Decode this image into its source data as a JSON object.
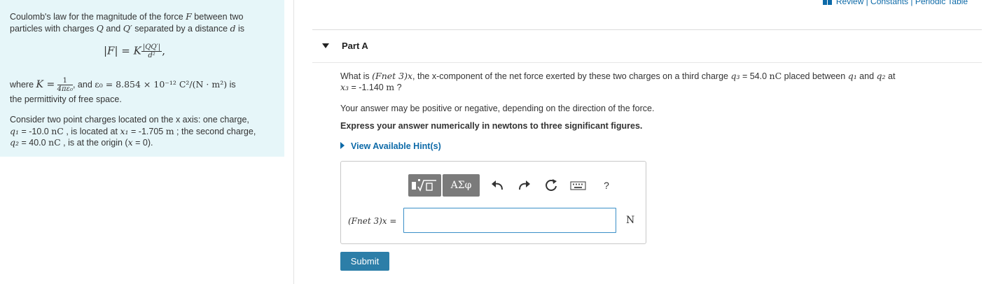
{
  "header": {
    "links": "Review | Constants | Periodic Table"
  },
  "intro": {
    "line1_a": "Coulomb's law for the magnitude of the force ",
    "line1_F": "F",
    "line1_b": " between two",
    "line2_a": "particles with charges ",
    "line2_Q": "Q",
    "line2_and": " and ",
    "line2_Qp": "Q′",
    "line2_b": " separated by a distance ",
    "line2_d": "d",
    "line2_c": " is",
    "formula_lhs": "|F| = K",
    "formula_num": "|QQ′|",
    "formula_den": "d²",
    "formula_end": ",",
    "where_a": "where ",
    "where_K": "K =",
    "where_num": "1",
    "where_den": "4πε₀",
    "where_b": ", and ",
    "where_eps": "ε₀ = 8.854 × 10⁻¹² C²/(N · m²)",
    "where_c": " is",
    "perm": "the permittivity of free space.",
    "consider_1": "Consider two point charges located on the x axis: one charge,",
    "consider_2a": "q₁",
    "consider_2b": " = -10.0 ",
    "consider_2c": "nC",
    "consider_2d": " , is located at ",
    "consider_2e": "x₁",
    "consider_2f": " = -1.705 ",
    "consider_2g": "m",
    "consider_2h": " ; the second charge,",
    "consider_3a": "q₂",
    "consider_3b": " = 40.0 ",
    "consider_3c": "nC",
    "consider_3d": " , is at the origin (",
    "consider_3e": "x",
    "consider_3f": " = 0)."
  },
  "part": {
    "title": "Part A",
    "question_1a": "What is ",
    "question_1b": "(Fnet 3)x",
    "question_1c": ", the x-component of the net force exerted by these two charges on a third charge ",
    "question_1d": "q₃",
    "question_1e": " = 54.0 ",
    "question_1f": "nC",
    "question_1g": " placed between ",
    "question_1h": "q₁",
    "question_1i": " and ",
    "question_1j": "q₂",
    "question_1k": " at",
    "question_2a": "x₃",
    "question_2b": " = -1.140 ",
    "question_2c": "m",
    "question_2d": " ?",
    "note": "Your answer may be positive or negative, depending on the direction of the force.",
    "instruction": "Express your answer numerically in newtons to three significant figures.",
    "hint": "View Available Hint(s)"
  },
  "answer": {
    "greek_label": "ΑΣφ",
    "help_label": "?",
    "input_label": "(Fnet 3)x =",
    "input_value": "",
    "unit": "N"
  },
  "submit_label": "Submit",
  "colors": {
    "panel_bg": "#e6f6f9",
    "link": "#0d6aa8",
    "submit_bg": "#2c7ea8",
    "input_border": "#3a8fc7"
  }
}
